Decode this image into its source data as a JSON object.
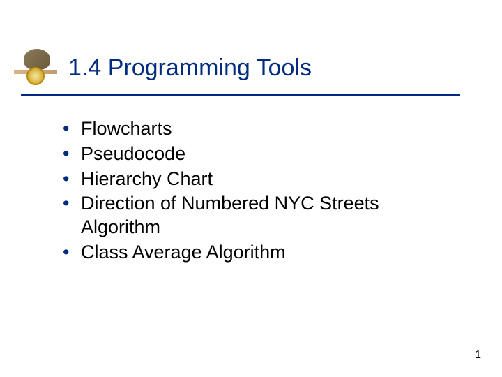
{
  "title": "1.4 Programming Tools",
  "bullets": [
    "Flowcharts",
    "Pseudocode",
    "Hierarchy Chart",
    "Direction of Numbered NYC Streets Algorithm",
    "Class Average Algorithm"
  ],
  "pageNumber": "1"
}
